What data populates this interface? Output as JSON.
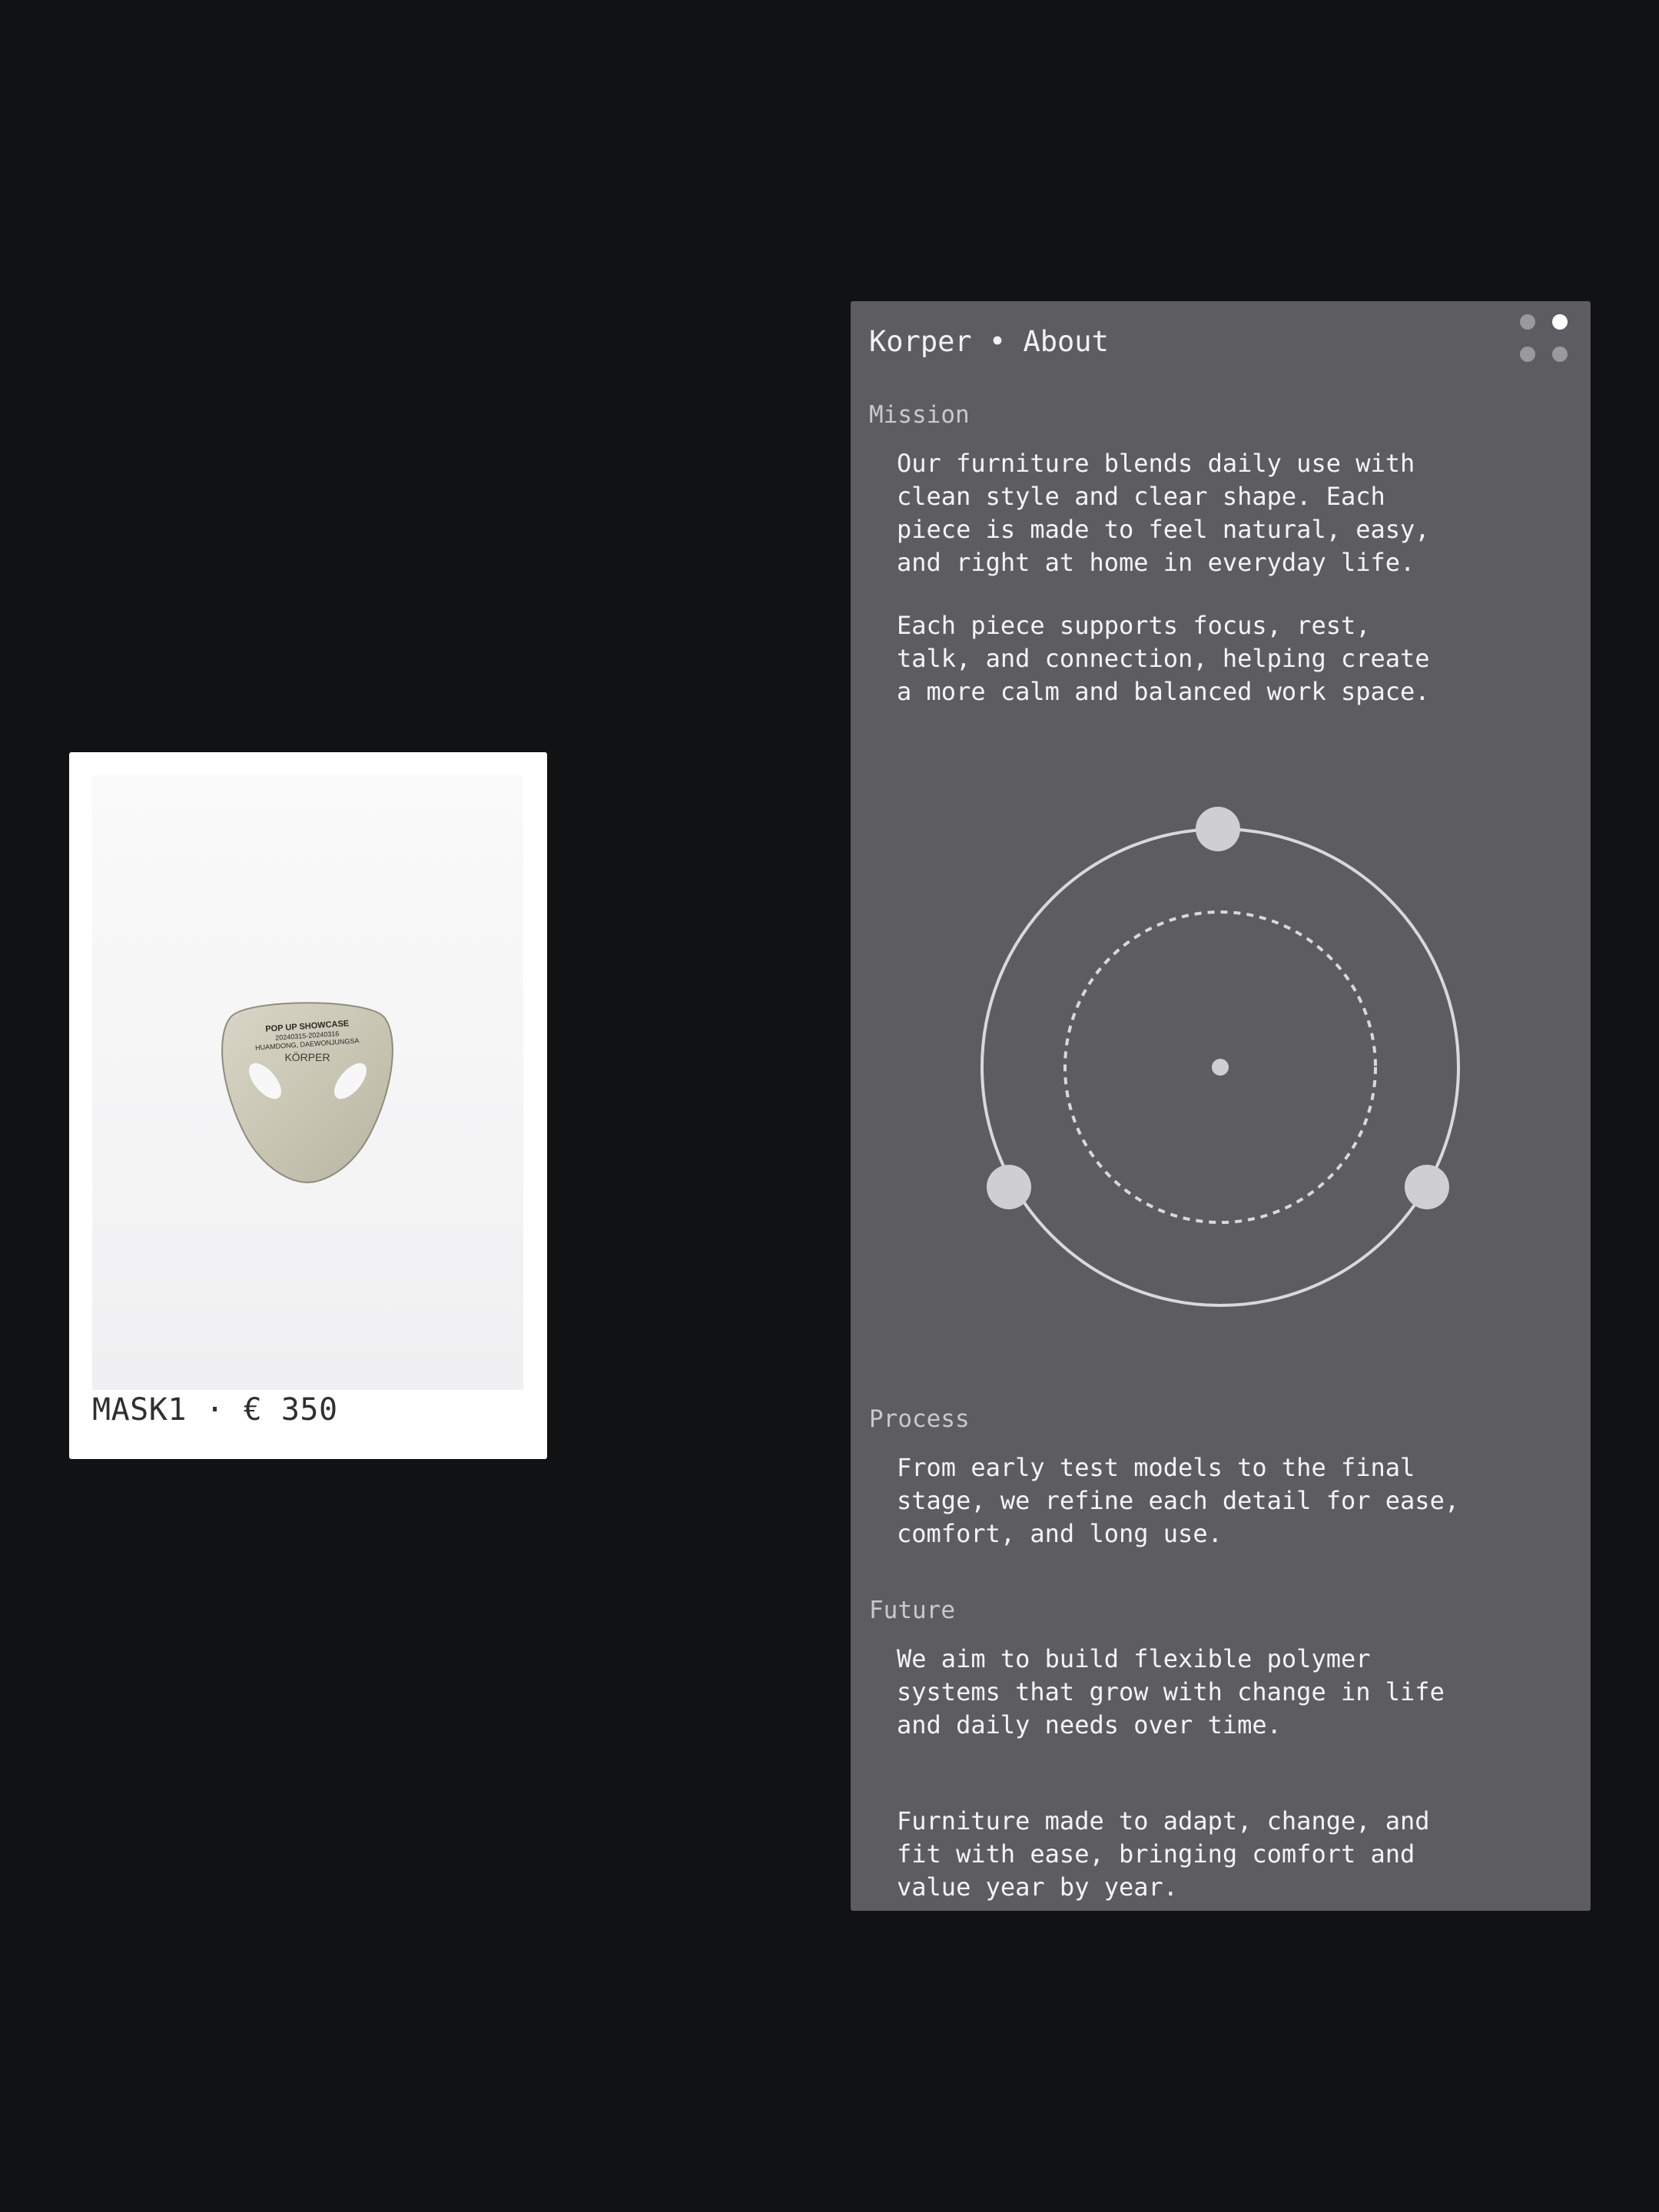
{
  "product": {
    "caption": "MASK1 · € 350",
    "image_alt": "Korper mask product photo",
    "mask_engraving": [
      "POP UP SHOWCASE",
      "20240315-20240316",
      "HUAMDONG, DAEWONJUNGSA",
      "KÖRPER"
    ]
  },
  "panel": {
    "title": "Korper • About",
    "window_dots": [
      {
        "active": false
      },
      {
        "active": true
      },
      {
        "active": false
      },
      {
        "active": false
      }
    ]
  },
  "mission": {
    "heading": "Mission",
    "paragraphs": [
      "Our furniture blends daily use with\nclean style and clear shape. Each\npiece is made to feel natural, easy,\nand right at home in everyday life.",
      "Each piece supports focus, rest,\ntalk, and connection, helping create\na more calm and balanced work space."
    ]
  },
  "process": {
    "heading": "Process",
    "paragraphs": [
      "From early test models to the final\nstage, we refine each detail for ease,\ncomfort, and long use."
    ]
  },
  "future": {
    "heading": "Future",
    "paragraphs": [
      "We aim to build flexible polymer\nsystems that grow with change in life\nand daily needs over time.",
      "Furniture made to adapt, change, and\nfit with ease, bringing comfort and\nvalue year by year."
    ]
  },
  "colors": {
    "page_background": "#111213",
    "panel_background": "#5d5d61",
    "card_background": "#ffffff",
    "diagram_stroke": "#d9d9dc",
    "node_fill": "#cfcfd2"
  }
}
